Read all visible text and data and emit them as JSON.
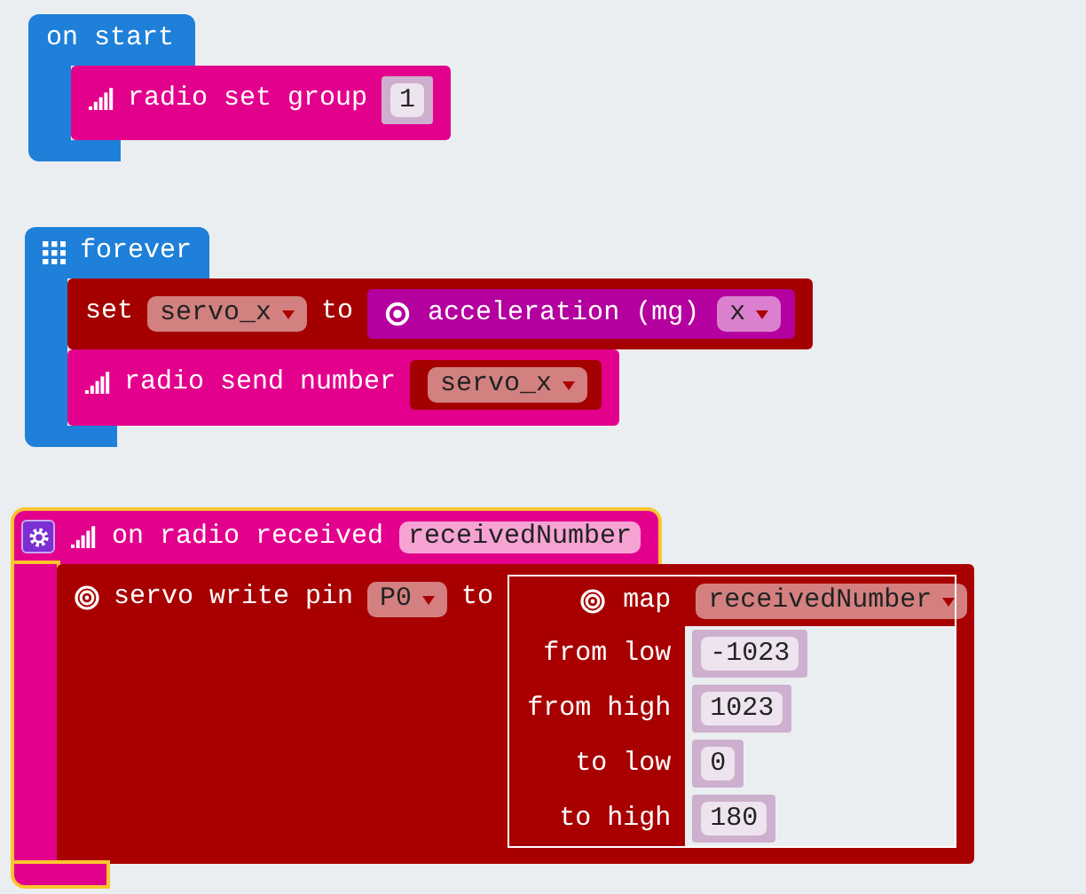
{
  "stacks": [
    {
      "kind": "basic",
      "selected": false,
      "label": "on start",
      "body": [
        {
          "kind": "radio",
          "icon": true,
          "parts": [
            {
              "kind": "text",
              "text": "radio set group"
            },
            {
              "kind": "number",
              "text": "1"
            }
          ]
        }
      ]
    },
    {
      "kind": "basic",
      "icon": true,
      "selected": false,
      "label": "forever",
      "body": [
        {
          "kind": "variables",
          "parts": [
            {
              "kind": "text",
              "text": "set"
            },
            {
              "kind": "dropdown",
              "text": "servo_x"
            },
            {
              "kind": "text",
              "text": "to"
            },
            {
              "kind": "sensor",
              "icon": true,
              "parts": [
                {
                  "kind": "text",
                  "text": "acceleration (mg)"
                },
                {
                  "kind": "dropdown",
                  "text": "x"
                }
              ]
            }
          ]
        },
        {
          "kind": "radio",
          "icon": true,
          "parts": [
            {
              "kind": "text",
              "text": "radio send number"
            },
            {
              "kind": "variable",
              "parts": [
                {
                  "kind": "dropdown",
                  "text": "servo_x"
                }
              ]
            }
          ]
        }
      ]
    },
    {
      "kind": "radio",
      "icon": true,
      "selected": true,
      "settings_button": true,
      "label": "on radio received",
      "parameters": [
        {
          "text": "receivedNumber"
        }
      ],
      "body": [
        {
          "kind": "pins",
          "icon": true,
          "parts": [
            {
              "kind": "text",
              "text": "servo write pin"
            },
            {
              "kind": "dropdown",
              "text": "P0"
            },
            {
              "kind": "text",
              "text": "to"
            },
            {
              "kind": "map",
              "icon": true,
              "rows": [
                {
                  "label": "map",
                  "slot": {
                    "kind": "dropdown",
                    "text": "receivedNumber"
                  }
                },
                {
                  "label": "from low",
                  "slot": {
                    "kind": "number",
                    "text": "-1023"
                  }
                },
                {
                  "label": "from high",
                  "slot": {
                    "kind": "number",
                    "text": "1023"
                  }
                },
                {
                  "label": "to low",
                  "slot": {
                    "kind": "number",
                    "text": "0"
                  }
                },
                {
                  "label": "to high",
                  "slot": {
                    "kind": "number",
                    "text": "180"
                  }
                }
              ]
            }
          ]
        }
      ]
    }
  ]
}
